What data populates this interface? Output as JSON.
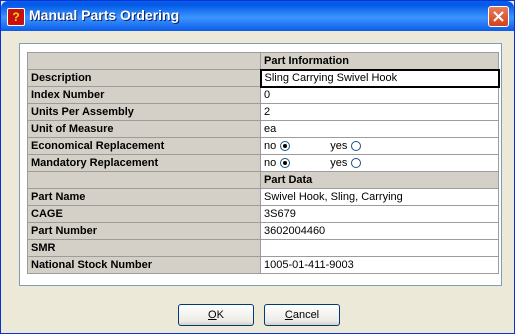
{
  "window": {
    "title": "Manual Parts Ordering",
    "icon": "app-question-icon",
    "close_icon": "close-icon"
  },
  "sections": {
    "info_header": "Part Information",
    "data_header": "Part Data"
  },
  "rows": [
    {
      "label": "Description",
      "value": "Sling Carrying Swivel Hook"
    },
    {
      "label": "Index Number",
      "value": "0"
    },
    {
      "label": "Units Per Assembly",
      "value": "2"
    },
    {
      "label": "Unit of Measure",
      "value": "ea"
    },
    {
      "label": "Economical Replacement",
      "no": "no",
      "yes": "yes",
      "selected": "no"
    },
    {
      "label": "Mandatory Replacement",
      "no": "no",
      "yes": "yes",
      "selected": "no"
    }
  ],
  "data_rows": [
    {
      "label": "Part Name",
      "value": "Swivel Hook, Sling, Carrying"
    },
    {
      "label": "CAGE",
      "value": "3S679"
    },
    {
      "label": "Part Number",
      "value": "3602004460"
    },
    {
      "label": "SMR",
      "value": ""
    },
    {
      "label": "National Stock Number",
      "value": "1005-01-411-9003"
    }
  ],
  "buttons": {
    "ok_first": "O",
    "ok_rest": "K",
    "cancel_first": "C",
    "cancel_rest": "ancel"
  }
}
